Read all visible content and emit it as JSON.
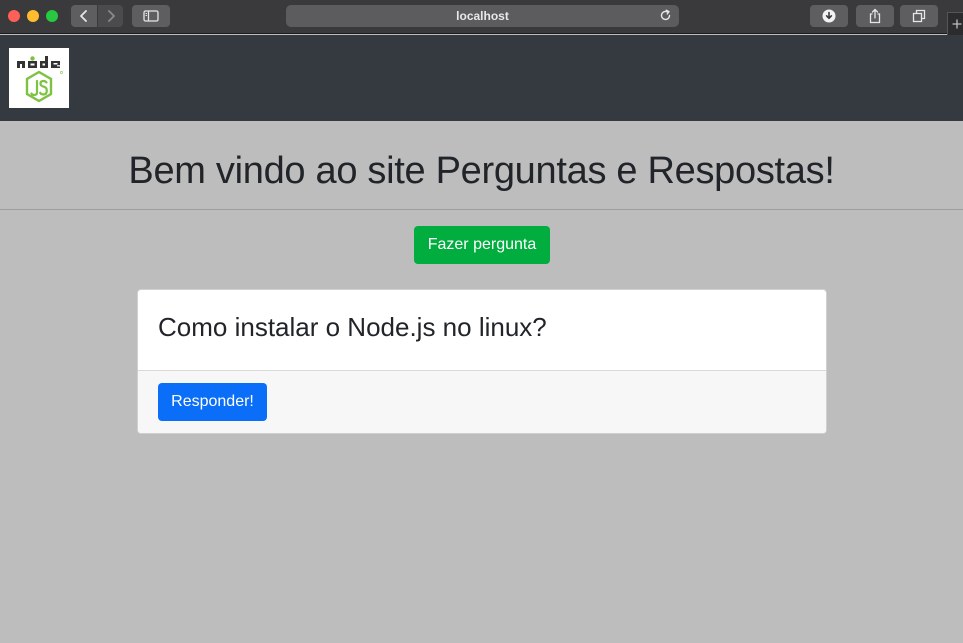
{
  "browser": {
    "address": "localhost",
    "icons": [
      "back-icon",
      "forward-icon",
      "sidebar-icon",
      "reload-icon",
      "download-icon",
      "share-icon",
      "tabs-icon",
      "plus-icon"
    ]
  },
  "navbar": {
    "logo": {
      "word": "node",
      "badge": "JS",
      "icon": "nodejs-logo"
    },
    "background": "#343a40"
  },
  "main": {
    "title": "Bem vindo ao site Perguntas e Respostas!",
    "ask_button_label": "Fazer pergunta",
    "questions": [
      {
        "title": "Como instalar o Node.js no linux?",
        "answer_button_label": "Responder!"
      }
    ]
  },
  "colors": {
    "page_background": "#bdbdbd",
    "ask_button": "#00ad3e",
    "answer_button": "#0a6ef8",
    "node_green": "#7ec242"
  }
}
